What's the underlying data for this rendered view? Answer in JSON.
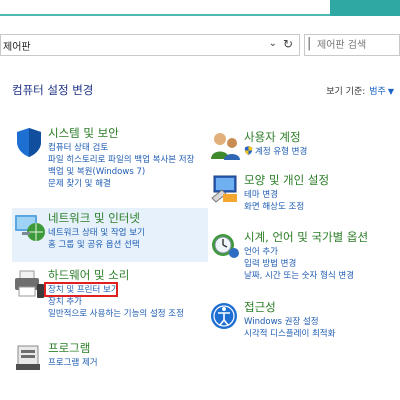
{
  "address": {
    "breadcrumb": "제어판",
    "dropdown_icon": "chevron-down-icon",
    "refresh_icon": "refresh-icon"
  },
  "search": {
    "placeholder": "제어판 검색"
  },
  "header": {
    "title": "컴퓨터 설정 변경",
    "viewby_label": "보기 기준:",
    "viewby_value": "범주"
  },
  "categories": [
    {
      "title": "시스템 및 보안",
      "links": [
        "컴퓨터 상태 검토",
        "파일 히스토리로 파일의 백업 복사본 저장",
        "백업 및 복원(Windows 7)",
        "문제 찾기 및 해결"
      ]
    },
    {
      "title": "네트워크 및 인터넷",
      "links": [
        "네트워크 상태 및 작업 보기",
        "홈 그룹 및 공유 옵션 선택"
      ]
    },
    {
      "title": "하드웨어 및 소리",
      "links": [
        "장치 및 프린터 보기",
        "장치 추가",
        "일반적으로 사용하는 기능의 설정 조정"
      ]
    },
    {
      "title": "프로그램",
      "links": [
        "프로그램 제거"
      ]
    },
    {
      "title": "사용자 계정",
      "links": [
        "계정 유형 변경"
      ]
    },
    {
      "title": "모양 및 개인 설정",
      "links": [
        "테마 변경",
        "화면 해상도 조정"
      ]
    },
    {
      "title": "시계, 언어 및 국가별 옵션",
      "links": [
        "언어 추가",
        "입력 방법 변경",
        "날짜, 시간 또는 숫자 형식 변경"
      ]
    },
    {
      "title": "접근성",
      "links": [
        "Windows 권장 설정",
        "시각적 디스플레이 최적화"
      ]
    }
  ],
  "colors": {
    "title_green": "#2b7d27",
    "link_blue": "#1f5db3",
    "header_blue": "#1e3287",
    "highlight_red": "#e0201e",
    "accent_teal": "#2fa7a3"
  }
}
